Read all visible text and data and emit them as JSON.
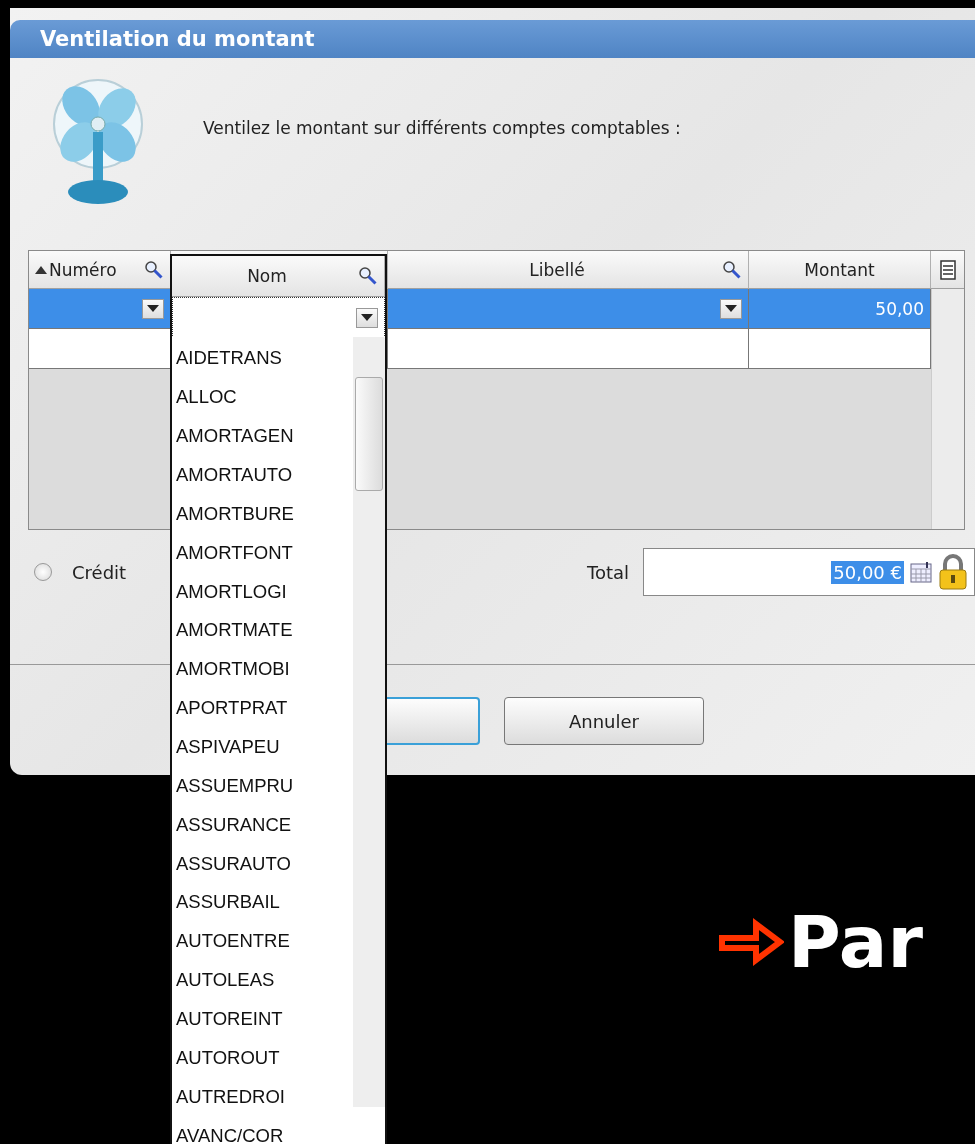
{
  "window": {
    "title": "Ventilation du montant"
  },
  "prompt": "Ventilez le montant sur différents comptes comptables :",
  "grid": {
    "columns": [
      {
        "label": "Numéro",
        "kind": "sorted"
      },
      {
        "label": "Nom",
        "kind": "popped"
      },
      {
        "label": "Libellé",
        "kind": "search"
      },
      {
        "label": "Montant",
        "kind": "plain"
      }
    ],
    "rows": [
      {
        "selected": true,
        "montant": "50,00"
      },
      {
        "selected": false
      }
    ]
  },
  "credit": {
    "label": "Crédit",
    "checked": false
  },
  "total": {
    "label": "Total",
    "value": "50,00 €"
  },
  "buttons": [
    {
      "label": "Annuler"
    }
  ],
  "dropdown": {
    "items": [
      "AIDETRANS",
      "ALLOC",
      "AMORTAGEN",
      "AMORTAUTO",
      "AMORTBURE",
      "AMORTFONT",
      "AMORTLOGI",
      "AMORTMATE",
      "AMORTMOBI",
      "APORTPRAT",
      "ASPIVAPEU",
      "ASSUEMPRU",
      "ASSURANCE",
      "ASSURAUTO",
      "ASSURBAIL",
      "AUTOENTRE",
      "AUTOLEAS",
      "AUTOREINT",
      "AUTOROUT",
      "AUTREDROI",
      "AVANC/COR"
    ]
  },
  "slide": {
    "text": "Par"
  }
}
